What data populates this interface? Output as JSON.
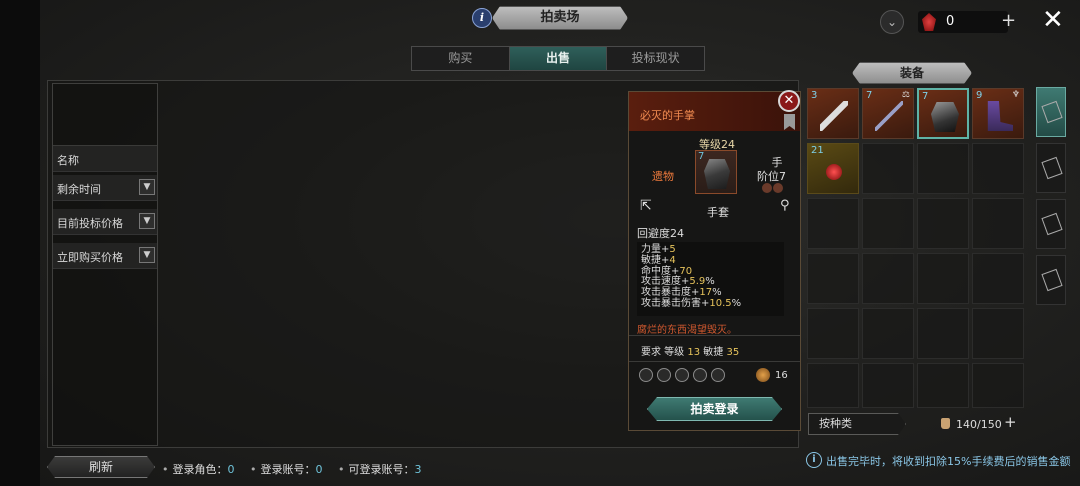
{
  "header": {
    "title": "拍卖场",
    "currency_value": "0"
  },
  "tabs": [
    "购买",
    "出售",
    "投标现状"
  ],
  "filters": {
    "name_label": "名称",
    "time_left_label": "剩余时间",
    "current_bid_label": "目前投标价格",
    "buyout_label": "立即购买价格"
  },
  "item_tooltip": {
    "name": "必灭的手掌",
    "level": "等级24",
    "rarity": "遗物",
    "slot": "手",
    "tier": "阶位7",
    "item_tier_num": "7",
    "type": "手套",
    "evasion": "回避度24",
    "stats": [
      {
        "label": "力量+",
        "value": "5",
        "unit": ""
      },
      {
        "label": "敏捷+",
        "value": "4",
        "unit": ""
      },
      {
        "label": "命中度+",
        "value": "70",
        "unit": ""
      },
      {
        "label": "攻击速度+",
        "value": "5.9",
        "unit": "%"
      },
      {
        "label": "攻击暴击度+",
        "value": "17",
        "unit": "%"
      },
      {
        "label": "攻击暴击伤害+",
        "value": "10.5",
        "unit": "%"
      }
    ],
    "flavor": "腐烂的东西渴望毁灭。",
    "requirement_prefix": "要求 等级 ",
    "requirement_level": "13",
    "requirement_mid": " 敏捷 ",
    "requirement_dex": "35",
    "price": "16",
    "sell_button": "拍卖登录"
  },
  "equipment": {
    "title": "装备",
    "slots": [
      {
        "num": "3",
        "mark": ""
      },
      {
        "num": "7",
        "mark": "⚖"
      },
      {
        "num": "7",
        "mark": ""
      },
      {
        "num": "9",
        "mark": "♆"
      },
      {
        "num": "21",
        "mark": ""
      }
    ],
    "sort_label": "按种类",
    "bag_count": "140/150"
  },
  "footer": {
    "refresh_label": "刷新",
    "login_chars_label": "登录角色：",
    "login_chars_value": "0",
    "login_accounts_label": "登录账号：",
    "login_accounts_value": "0",
    "available_accounts_label": "可登录账号：",
    "available_accounts_value": "3",
    "notice": "出售完毕时，将收到扣除15%手续费后的销售金额"
  },
  "colors": {
    "accent_teal": "#2f5f5a",
    "rarity_orange": "#ef7a3c",
    "stat_gold": "#e6c35c",
    "info_blue": "#8ac6e6"
  }
}
